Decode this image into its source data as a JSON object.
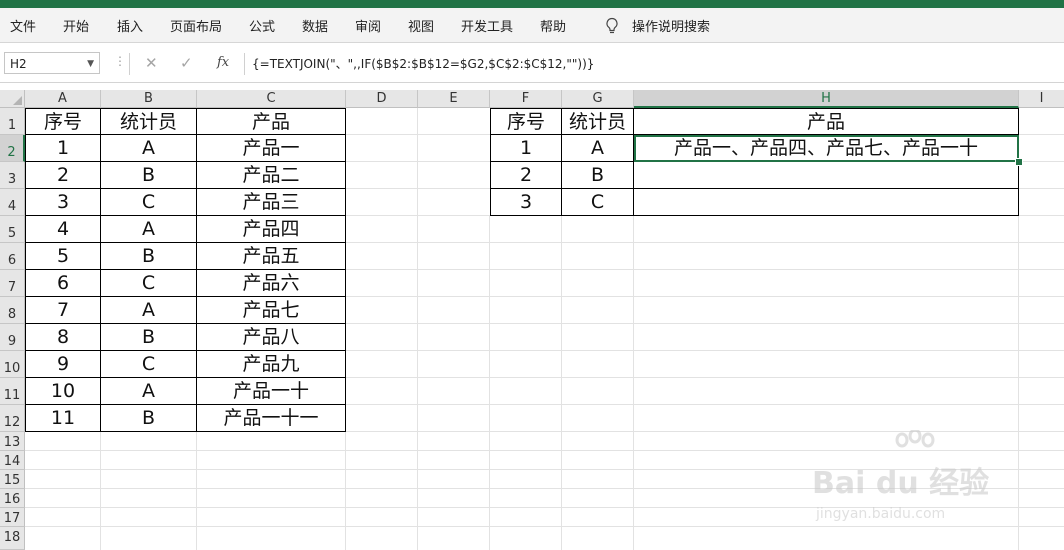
{
  "ribbon": {
    "tabs": [
      "文件",
      "开始",
      "插入",
      "页面布局",
      "公式",
      "数据",
      "审阅",
      "视图",
      "开发工具",
      "帮助"
    ],
    "search_label": "操作说明搜索"
  },
  "formula_bar": {
    "name_box": "H2",
    "fx_label": "fx",
    "formula": "{=TEXTJOIN(\"、\",,IF($B$2:$B$12=$G2,$C$2:$C$12,\"\"))}"
  },
  "columns": [
    "A",
    "B",
    "C",
    "D",
    "E",
    "F",
    "G",
    "H",
    "I"
  ],
  "rows": [
    "1",
    "2",
    "3",
    "4",
    "5",
    "6",
    "7",
    "8",
    "9",
    "10",
    "11",
    "12",
    "13",
    "14",
    "15",
    "16",
    "17",
    "18"
  ],
  "selected_cell": "H2",
  "left_table": {
    "headers": [
      "序号",
      "统计员",
      "产品"
    ],
    "rows": [
      [
        "1",
        "A",
        "产品一"
      ],
      [
        "2",
        "B",
        "产品二"
      ],
      [
        "3",
        "C",
        "产品三"
      ],
      [
        "4",
        "A",
        "产品四"
      ],
      [
        "5",
        "B",
        "产品五"
      ],
      [
        "6",
        "C",
        "产品六"
      ],
      [
        "7",
        "A",
        "产品七"
      ],
      [
        "8",
        "B",
        "产品八"
      ],
      [
        "9",
        "C",
        "产品九"
      ],
      [
        "10",
        "A",
        "产品一十"
      ],
      [
        "11",
        "B",
        "产品一十一"
      ]
    ]
  },
  "right_table": {
    "headers": [
      "序号",
      "统计员",
      "产品"
    ],
    "rows": [
      [
        "1",
        "A",
        "产品一、产品四、产品七、产品一十"
      ],
      [
        "2",
        "B",
        ""
      ],
      [
        "3",
        "C",
        ""
      ]
    ]
  },
  "watermark": {
    "text": "Bai du 经验",
    "sub": "jingyan.baidu.com"
  }
}
